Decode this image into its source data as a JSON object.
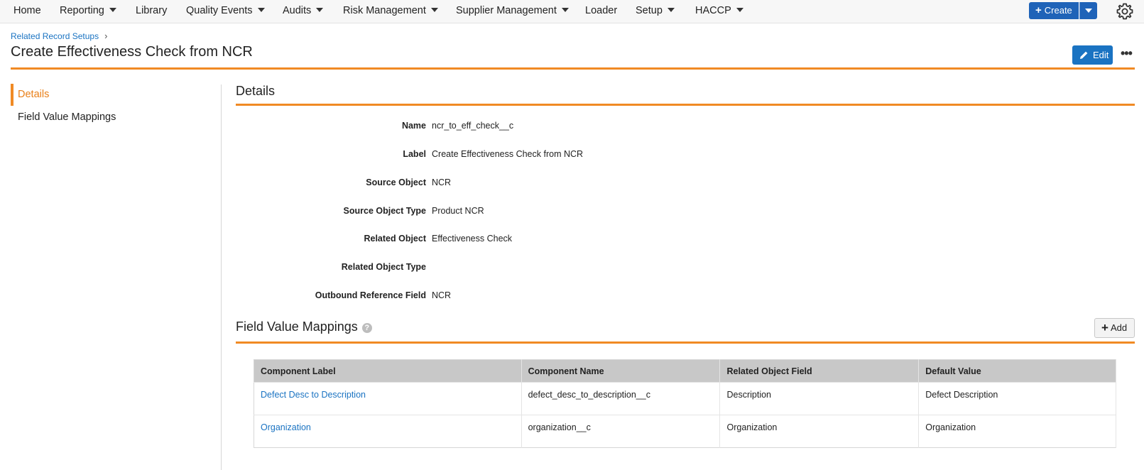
{
  "nav": {
    "home": "Home",
    "reporting": "Reporting",
    "library": "Library",
    "quality_events": "Quality Events",
    "audits": "Audits",
    "risk_management": "Risk Management",
    "supplier_management": "Supplier Management",
    "loader": "Loader",
    "setup": "Setup",
    "haccp": "HACCP",
    "create_label": "Create"
  },
  "header": {
    "breadcrumb": "Related Record Setups",
    "title": "Create Effectiveness Check from NCR",
    "edit_label": "Edit"
  },
  "sidebar": {
    "items": [
      {
        "label": "Details",
        "active": true
      },
      {
        "label": "Field Value Mappings",
        "active": false
      }
    ]
  },
  "details": {
    "title": "Details",
    "fields": [
      {
        "label": "Name",
        "value": "ncr_to_eff_check__c"
      },
      {
        "label": "Label",
        "value": "Create Effectiveness Check from NCR"
      },
      {
        "label": "Source Object",
        "value": "NCR"
      },
      {
        "label": "Source Object Type",
        "value": "Product NCR"
      },
      {
        "label": "Related Object",
        "value": "Effectiveness Check"
      },
      {
        "label": "Related Object Type",
        "value": ""
      },
      {
        "label": "Outbound Reference Field",
        "value": "NCR"
      }
    ]
  },
  "mappings": {
    "title": "Field Value Mappings",
    "help_icon": "?",
    "add_label": "Add",
    "columns": [
      "Component Label",
      "Component Name",
      "Related Object Field",
      "Default Value"
    ],
    "rows": [
      [
        "Defect Desc to Description",
        "defect_desc_to_description__c",
        "Description",
        "Defect Description"
      ],
      [
        "Organization",
        "organization__c",
        "Organization",
        "Organization"
      ]
    ]
  },
  "colors": {
    "accent_orange": "#f08a24",
    "primary_blue": "#1f63b8",
    "link_blue": "#1a73c2"
  }
}
